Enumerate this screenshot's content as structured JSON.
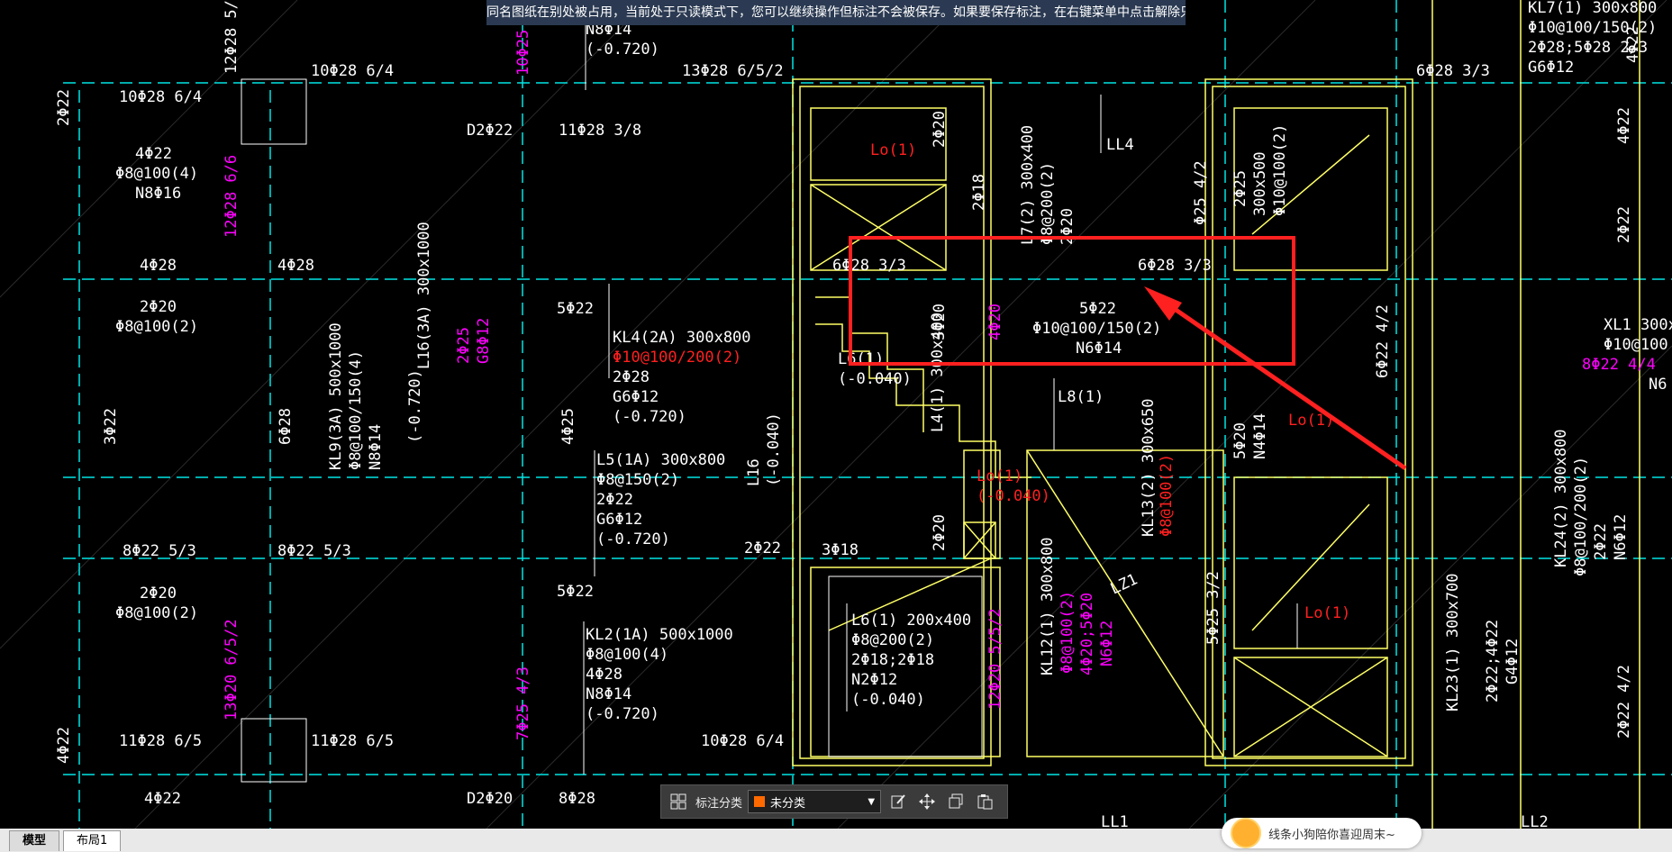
{
  "notice_bar": {
    "text": "同名图纸在别处被占用，当前处于只读模式下，您可以继续操作但标注不会被保存。如果要保存标注，在右键菜单中点击解除只读模式"
  },
  "colors": {
    "background": "#000000",
    "line_yellow": "#ffff66",
    "line_cyan": "#00e5e5",
    "text_white": "#ffffff",
    "text_magenta": "#ff00ff",
    "mark_red": "#ff2020"
  },
  "drawing": {
    "white_labels": [
      "10Φ28 6/4",
      "10Φ28 6/4",
      "13Φ28 6/5/2",
      "N8Φ14",
      "(-0.720)",
      "6Φ28 3/3",
      "KL7(1) 300x800",
      "Φ10@100/150(2)",
      "2Φ28;5Φ28 2/3",
      "G6Φ12",
      "4Φ22",
      "Φ8@100(4)",
      "N8Φ16",
      "D2Φ22",
      "11Φ28 3/8",
      "LL4",
      "4Φ28",
      "4Φ28",
      "6Φ28 3/3",
      "6Φ28 3/3",
      "2Φ20",
      "Φ8@100(2)",
      "5Φ22",
      "KL4(2A) 300x800",
      "2Φ28",
      "G6Φ12",
      "(-0.720)",
      "5Φ22",
      "Φ10@100/150(2)",
      "N6Φ14",
      "L8(1)",
      "L6(1)",
      "(-0.040)",
      "L5(1A) 300x800",
      "Φ8@150(2)",
      "2Φ22",
      "G6Φ12",
      "(-0.720)",
      "8Φ22 5/3",
      "8Φ22 5/3",
      "2Φ22",
      "3Φ18",
      "2Φ20",
      "Φ8@100(2)",
      "5Φ22",
      "KL2(1A) 500x1000",
      "Φ8@100(4)",
      "4Φ28",
      "N8Φ14",
      "(-0.720)",
      "L6(1) 200x400",
      "Φ8@200(2)",
      "2Φ18;2Φ18",
      "N2Φ12",
      "(-0.040)",
      "11Φ28 6/5",
      "11Φ28 6/5",
      "10Φ28 6/4",
      "4Φ22",
      "D2Φ20",
      "8Φ28",
      "LL1",
      "LL2",
      "XL1 300x8",
      "Φ10@100",
      "N6"
    ],
    "vertical_white_labels": [
      "12Φ28 5/5",
      "2Φ22",
      "L16(3A) 300x1000",
      "KL9(3A) 500x1000",
      "Φ8@100/150(4)",
      "N8Φ14",
      "(-0.720)",
      "3Φ22",
      "6Φ28",
      "4Φ25",
      "L16",
      "(-0.040)",
      "2Φ20",
      "2Φ18",
      "3Φ20",
      "L7(2) 300x400",
      "Φ8@200(2)",
      "2Φ20",
      "L4(1) 300x400",
      "2Φ20",
      "KL13(2) 300x650",
      "KL12(1) 300x800",
      "LZ1",
      "2Φ25",
      "300x500",
      "Φ10@100(2)",
      "Φ25 4/2",
      "5Φ25 3/2",
      "5Φ20",
      "N4Φ14",
      "6Φ22 4/2",
      "KL24(2) 300x800",
      "Φ8@100/200(2)",
      "2Φ22",
      "N6Φ12",
      "KL23(1) 300x700",
      "2Φ22;4Φ22",
      "G4Φ12",
      "4Φ22",
      "2Φ22",
      "4Φ22",
      "2Φ22 4/2",
      "4Φ22"
    ],
    "magenta_labels": [
      "12Φ28 6/6",
      "10Φ25",
      "2Φ25",
      "G8Φ12",
      "13Φ20 6/5/2",
      "7Φ25 4/3",
      "12Φ20 5/5/2",
      "Φ8@100(2)",
      "4Φ20;5Φ20",
      "N6Φ12",
      "8Φ22 4/4",
      "4Φ20"
    ],
    "red_labels": [
      "Lo(1)",
      "Lo(1)",
      "Lo(1)",
      "Lo(1)",
      "Φ10@100/200(2)",
      "(-0.040)",
      "Φ8@100(2)"
    ]
  },
  "annotation_toolbar": {
    "category_label": "标注分类",
    "category_value": "未分类",
    "swatch_color": "#ff6a00",
    "icons": [
      "grid-icon",
      "edit-icon",
      "move-icon",
      "copy-icon",
      "paste-icon"
    ]
  },
  "bottom_tabs": {
    "model": "模型",
    "layout1": "布局1"
  },
  "toast": {
    "text": "线条小狗陪你喜迎周末~"
  }
}
